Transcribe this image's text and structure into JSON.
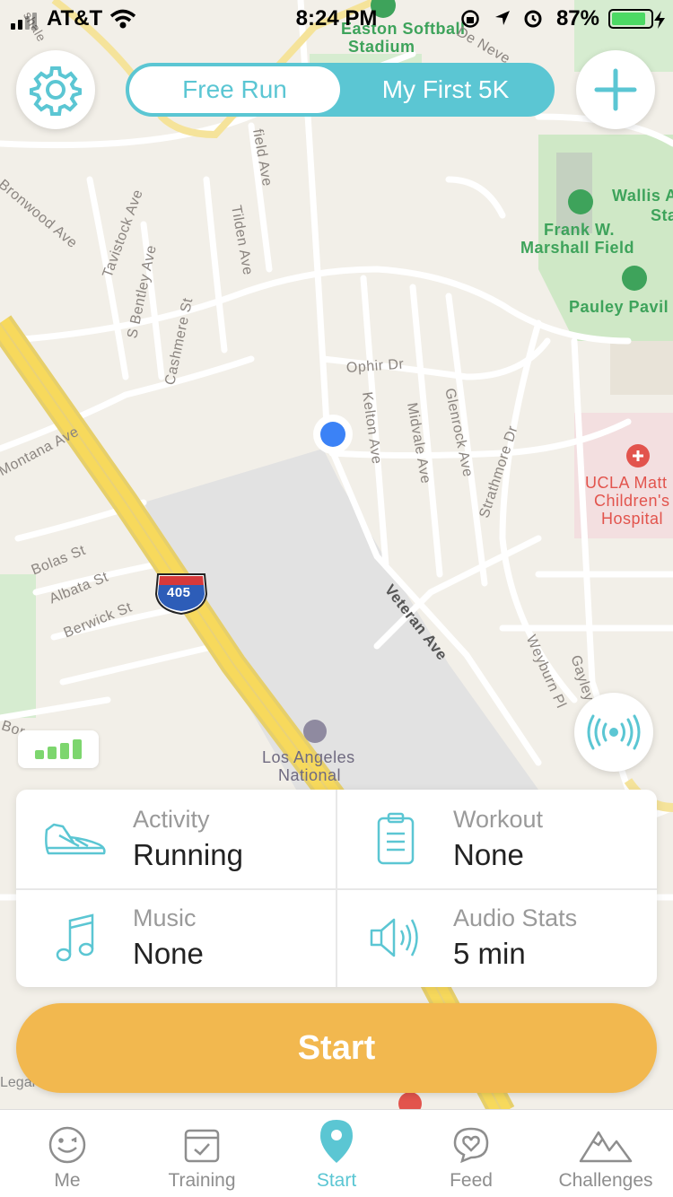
{
  "status_bar": {
    "carrier": "AT&T",
    "time": "8:24 PM",
    "battery_pct": "87%"
  },
  "mode_toggle": {
    "free_run": "Free Run",
    "plan": "My First 5K"
  },
  "map_labels": {
    "easton": "Easton Softball",
    "stadium": "Stadium",
    "de_neve": "De Neve",
    "field_ave": "field Ave",
    "bronwood": "Bronwood Ave",
    "tavistock": "Tavistock Ave",
    "tilden": "Tilden Ave",
    "s_bentley": "S Bentley Ave",
    "cashmere": "Cashmere St",
    "wallis": "Wallis A",
    "sta": "Sta",
    "frank_w": "Frank W.",
    "marshall": "Marshall Field",
    "pauley": "Pauley Pavil",
    "ophir": "Ophir Dr",
    "kelton": "Kelton Ave",
    "midvale": "Midvale Ave",
    "glenrock": "Glenrock Ave",
    "strathmore": "Strathmore Dr",
    "montana": "Montana Ave",
    "ucla1": "UCLA Matt",
    "ucla2": "Children's",
    "ucla3": "Hospital",
    "bolas": "Bolas St",
    "albata": "Albata St",
    "berwick": "Berwick St",
    "i405": "405",
    "veteran": "Veteran Ave",
    "weyburn": "Weyburn Pl",
    "gayley": "Gayley Ave",
    "la1": "Los Angeles",
    "la2": "National",
    "bor": "Bor",
    "shale": "shale"
  },
  "settings": {
    "activity": {
      "label": "Activity",
      "value": "Running",
      "icon": "running-shoe-icon"
    },
    "workout": {
      "label": "Workout",
      "value": "None",
      "icon": "clipboard-icon"
    },
    "music": {
      "label": "Music",
      "value": "None",
      "icon": "music-note-icon"
    },
    "audio_stats": {
      "label": "Audio Stats",
      "value": "5 min",
      "icon": "speaker-icon"
    }
  },
  "start_button": "Start",
  "legal": "Legal",
  "tabs": [
    {
      "label": "Me",
      "icon": "smiley-icon"
    },
    {
      "label": "Training",
      "icon": "calendar-check-icon"
    },
    {
      "label": "Start",
      "icon": "location-pin-icon"
    },
    {
      "label": "Feed",
      "icon": "chat-heart-icon"
    },
    {
      "label": "Challenges",
      "icon": "mountain-icon"
    }
  ],
  "colors": {
    "accent": "#5bc6d3",
    "start": "#f2b84f",
    "signal": "#7dd66e",
    "location_dot": "#3b82f6"
  }
}
